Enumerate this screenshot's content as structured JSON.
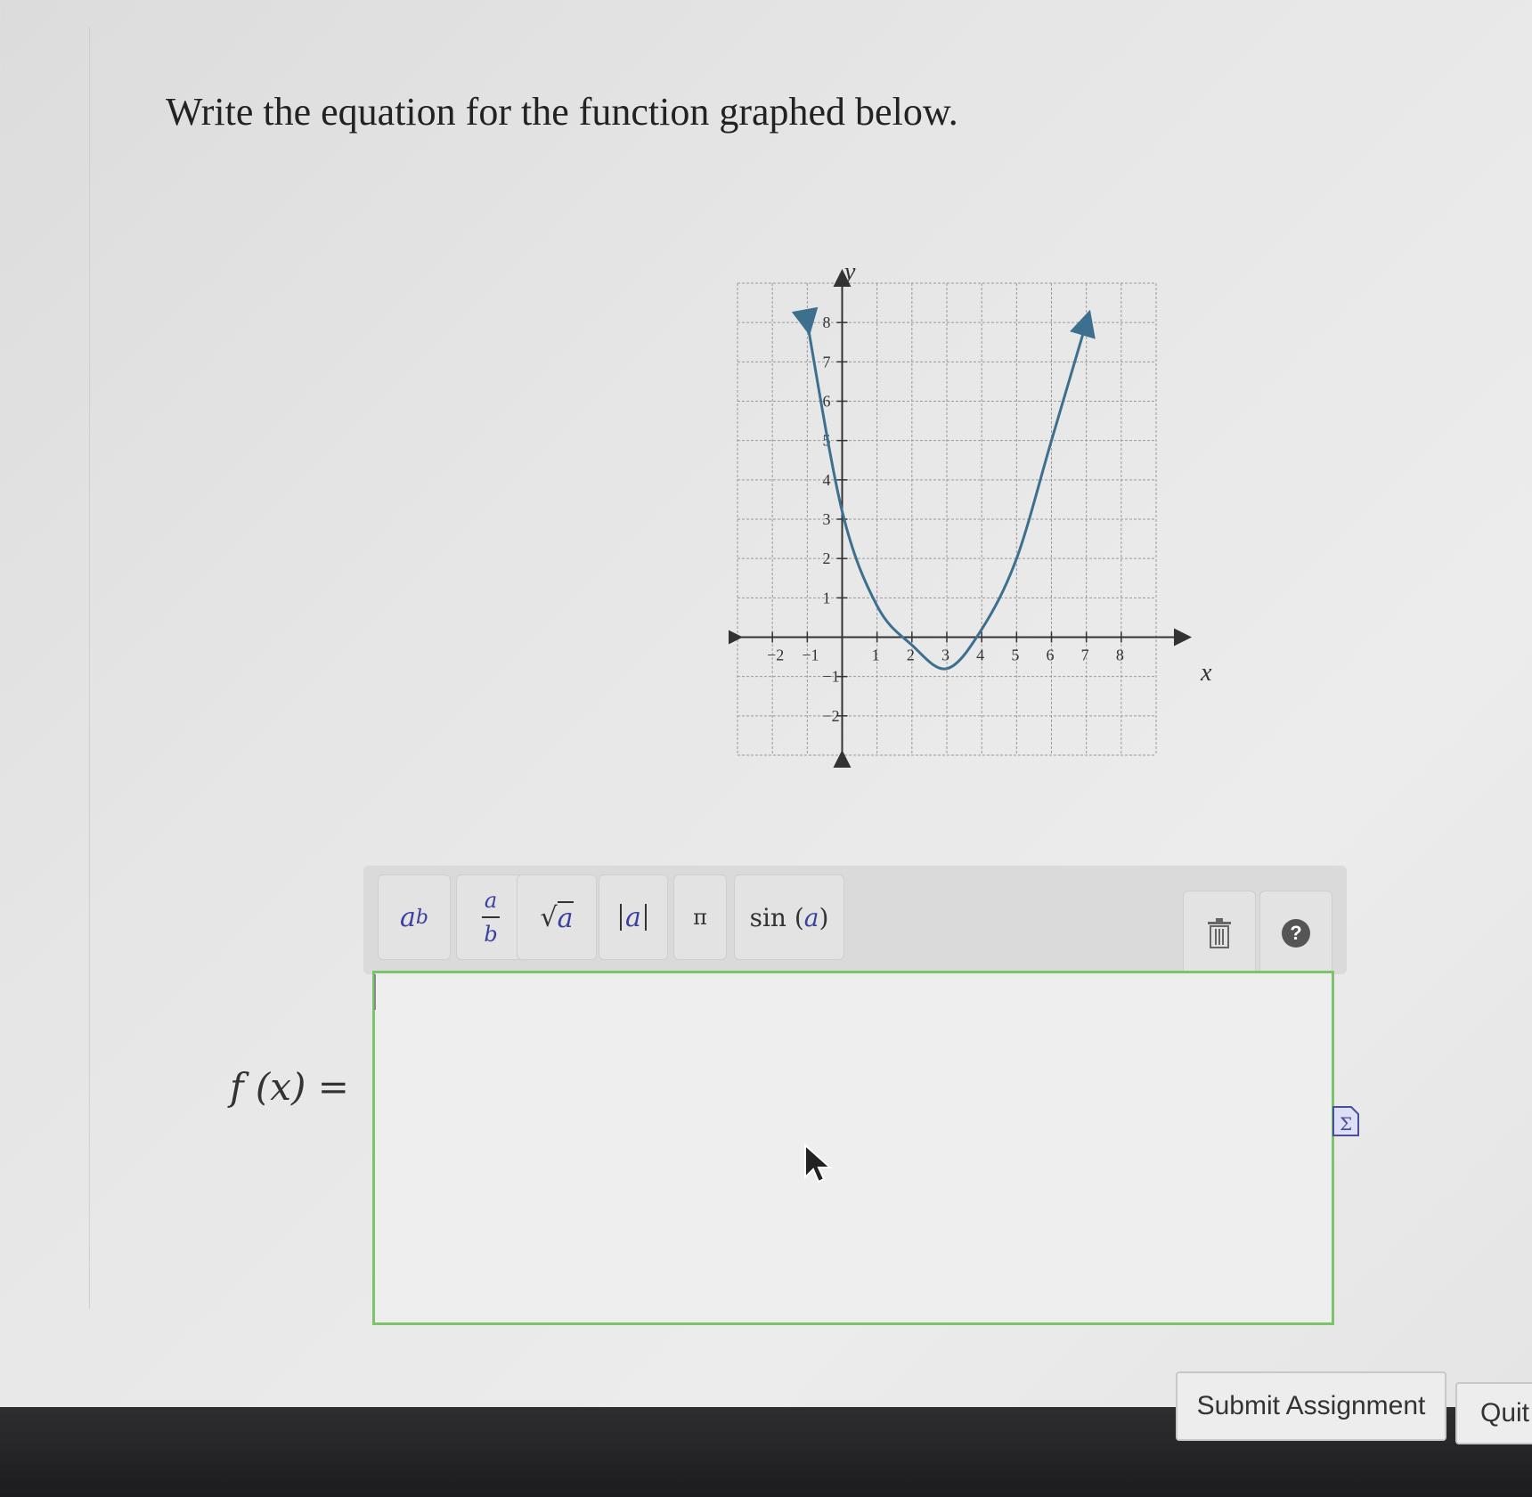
{
  "question": {
    "text": "Write the equation for the function graphed below."
  },
  "graph": {
    "x_axis_label": "x",
    "y_axis_label": "y",
    "x_ticks": [
      "−2",
      "−1",
      "1",
      "2",
      "3",
      "4",
      "5",
      "6",
      "7",
      "8"
    ],
    "y_ticks": [
      "8",
      "7",
      "6",
      "5",
      "4",
      "3",
      "2",
      "1",
      "−1",
      "−2"
    ],
    "curve_color": "#3d6f8f",
    "chart_data": {
      "type": "line",
      "x": [
        -1,
        0,
        1,
        2,
        3,
        4,
        5,
        6,
        7
      ],
      "y": [
        8,
        3.2,
        0.8,
        -0.2,
        -0.8,
        0.2,
        2,
        5,
        8
      ],
      "xlim": [
        -3,
        9
      ],
      "ylim": [
        -3,
        9
      ],
      "grid": true
    }
  },
  "toolbar": {
    "power": {
      "base": "a",
      "exp": "b"
    },
    "fraction": {
      "num": "a",
      "den": "b"
    },
    "sqrt": {
      "symbol": "√",
      "arg": "a"
    },
    "abs": {
      "arg": "a"
    },
    "pi": "π",
    "sin": {
      "fn": "sin",
      "arg": "a"
    }
  },
  "answer": {
    "label": "f (x) =",
    "value": ""
  },
  "buttons": {
    "submit": "Submit Assignment",
    "quit": "Quit"
  },
  "colors": {
    "answer_border": "#7cc46a",
    "help_bg": "#555555"
  }
}
